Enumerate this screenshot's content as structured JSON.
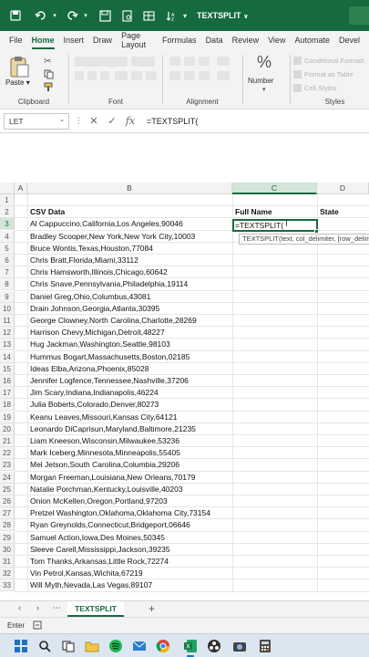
{
  "titlebar": {
    "title": "TEXTSPLIT",
    "title_caret": "∨"
  },
  "menu": {
    "tabs": [
      "File",
      "Home",
      "Insert",
      "Draw",
      "Page Layout",
      "Formulas",
      "Data",
      "Review",
      "View",
      "Automate",
      "Devel"
    ]
  },
  "ribbon": {
    "paste_label": "Paste",
    "clipboard_label": "Clipboard",
    "font_label": "Font",
    "alignment_label": "Alignment",
    "number_label": "Number",
    "styles_label": "Styles",
    "conditional_formatting": "Conditional Formatt",
    "format_as_table": "Format as Table",
    "cell_styles": "Cell Styles"
  },
  "formula_bar": {
    "name_box": "LET",
    "cancel_symbol": "✕",
    "enter_symbol": "✓",
    "fx_symbol": "fx",
    "formula": "=TEXTSPLIT("
  },
  "grid": {
    "columns": [
      "A",
      "B",
      "C",
      "D"
    ],
    "rows": [
      "1",
      "2",
      "3",
      "4",
      "5",
      "6",
      "7",
      "8",
      "9",
      "10",
      "11",
      "12",
      "13",
      "14",
      "15",
      "16",
      "17",
      "18",
      "19",
      "20",
      "21",
      "22",
      "23",
      "24",
      "25",
      "26",
      "27",
      "28",
      "29",
      "30",
      "31",
      "32",
      "33"
    ],
    "header_csv": "CSV Data",
    "header_fullname": "Full Name",
    "header_state": "State",
    "active_cell_value": "=TEXTSPLIT(",
    "tooltip": "TEXTSPLIT(text, col_delimiter, [row_delimiter], ...",
    "csv_rows": [
      "Al Cappuccino,California,Los Angeles,90046",
      "Bradley Scooper,New York,New York City,10003",
      "Bruce Wontis,Texas,Houston,77084",
      "Chris Bratt,Florida,Miami,33112",
      "Chris Hamsworth,Illinois,Chicago,60642",
      "Chris Snave,Pennsylvania,Philadelphia,19114",
      "Daniel Greg,Ohio,Columbus,43081",
      "Drain Johnson,Georgia,Atlanta,30395",
      "George Clowney,North Carolina,Charlotte,28269",
      "Harrison Chevy,Michigan,Detroit,48227",
      "Hug Jackman,Washington,Seattle,98103",
      "Hummus Bogart,Massachusetts,Boston,02185",
      "Ideas Elba,Arizona,Phoenix,85028",
      "Jennifer Logfence,Tennessee,Nashville,37206",
      "Jim Scary,Indiana,Indianapolis,46224",
      "Julia Boberts,Colorado,Denver,80273",
      "Keanu Leaves,Missouri,Kansas City,64121",
      "Leonardo DiCaprisun,Maryland,Baltimore,21235",
      "Liam Kneeson,Wisconsin,Milwaukee,53236",
      "Mark Iceberg,Minnesota,Minneapolis,55405",
      "Mel Jetson,South Carolina,Columbia,29206",
      "Morgan Freeman,Louisiana,New Orleans,70179",
      "Natalie Porchman,Kentucky,Louisville,40203",
      "Onion McKellen,Oregon,Portland,97203",
      "Pretzel Washington,Oklahoma,Oklahoma City,73154",
      "Ryan Greynolds,Connecticut,Bridgeport,06646",
      "Samuel Action,Iowa,Des Moines,50345",
      "Sleeve Carell,Mississippi,Jackson,39235",
      "Tom Thanks,Arkansas,Little Rock,72274",
      "Vin Petrol,Kansas,Wichita,67219",
      "Will Myth,Nevada,Las Vegas,89107"
    ]
  },
  "sheet_tabs": {
    "active": "TEXTSPLIT",
    "add_symbol": "+"
  },
  "status": {
    "mode": "Enter"
  },
  "colors": {
    "accent": "#166b3e",
    "excel_green": "#1d7044"
  }
}
